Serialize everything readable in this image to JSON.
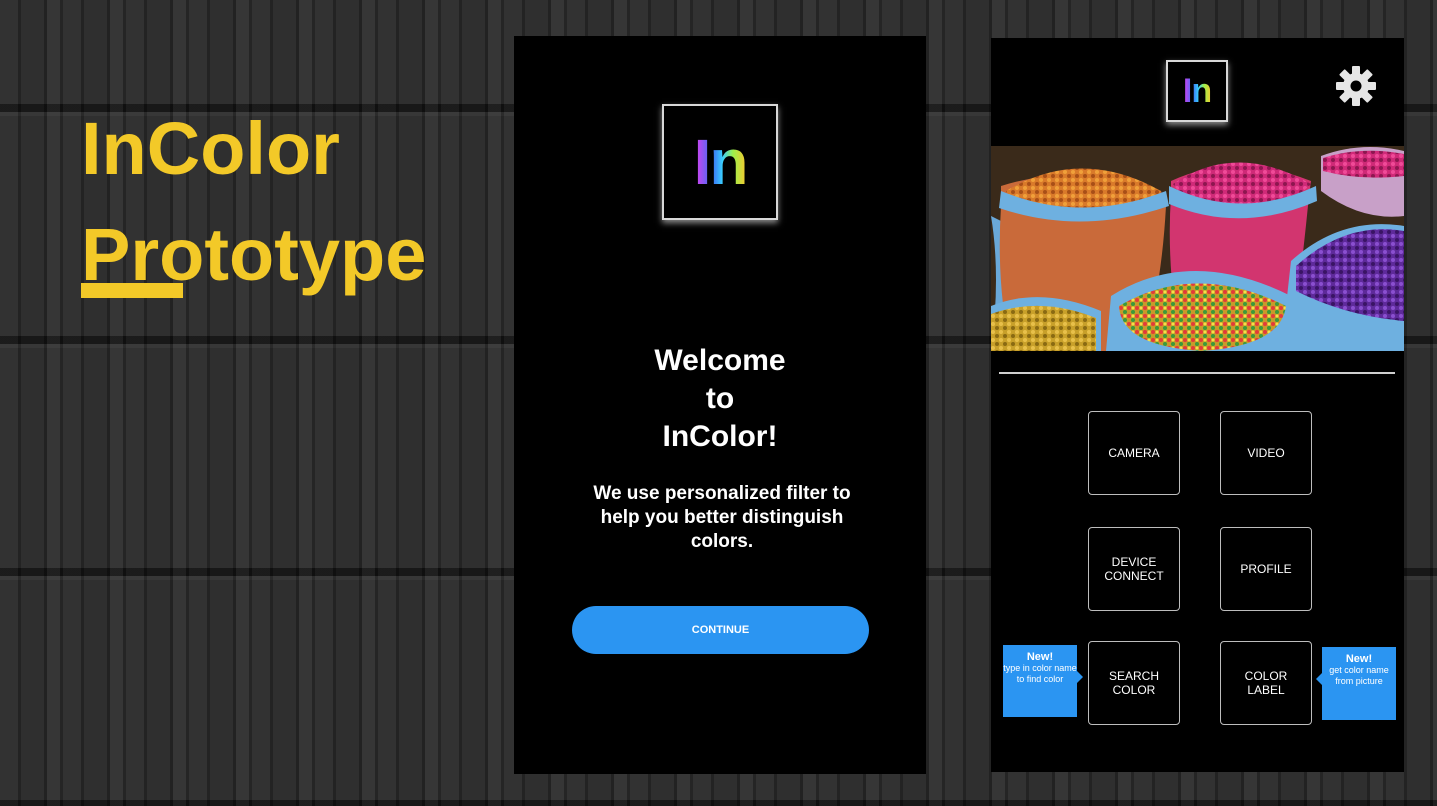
{
  "slide": {
    "title_line1": "InColor",
    "title_line2": "Prototype",
    "accent_color": "#f3c928"
  },
  "welcome_screen": {
    "logo_text": "In",
    "heading_line1": "Welcome",
    "heading_line2": "to",
    "heading_line3": "InColor!",
    "subtitle": "We use personalized filter to help you better distinguish colors.",
    "continue_label": "CONTINUE",
    "button_color": "#2b95f2"
  },
  "home_screen": {
    "logo_text": "In",
    "settings_icon": "gear-icon",
    "photo_description_icon": "spice-bags-photo",
    "buttons": {
      "camera": "CAMERA",
      "video": "VIDEO",
      "device_connect": "DEVICE\nCONNECT",
      "profile": "PROFILE",
      "search_color": "SEARCH\nCOLOR",
      "color_label": "COLOR\nLABEL"
    },
    "callout_left": {
      "title": "New!",
      "text": "type in color name to find color"
    },
    "callout_right": {
      "title": "New!",
      "text": "get color name from picture"
    }
  }
}
